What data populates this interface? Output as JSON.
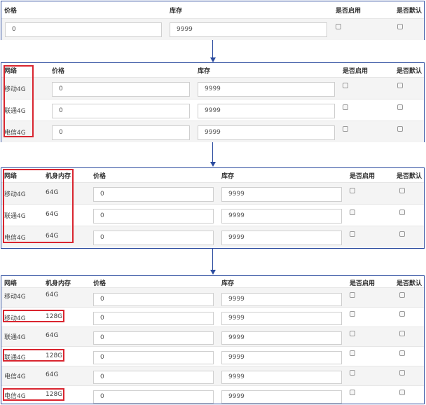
{
  "headers": {
    "network": "网络",
    "memory": "机身内存",
    "price": "价格",
    "stock": "库存",
    "enabled": "是否启用",
    "default": "是否默认"
  },
  "defaults": {
    "price": "0",
    "stock": "9999"
  },
  "networks": [
    "移动4G",
    "联通4G",
    "电信4G"
  ],
  "memory_64": "64G",
  "panel4_rows": [
    {
      "network": "移动4G",
      "memory": "64G"
    },
    {
      "network": "移动4G",
      "memory": "128G"
    },
    {
      "network": "联通4G",
      "memory": "64G"
    },
    {
      "network": "联通4G",
      "memory": "128G"
    },
    {
      "network": "电信4G",
      "memory": "64G"
    },
    {
      "network": "电信4G",
      "memory": "128G"
    }
  ],
  "colors": {
    "border": "#2a4a9e",
    "highlight": "#d9252f"
  }
}
